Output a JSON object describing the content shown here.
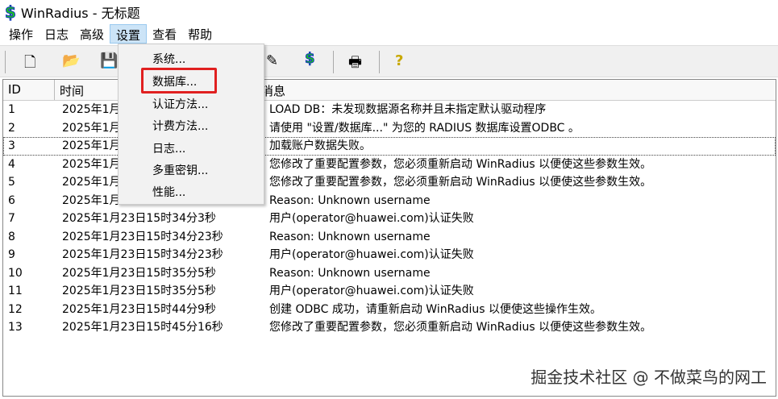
{
  "window": {
    "title": "WinRadius - 无标题"
  },
  "menubar": [
    "操作",
    "日志",
    "高级",
    "设置",
    "查看",
    "帮助"
  ],
  "toolbar": {
    "icons": [
      "new-icon",
      "open-icon",
      "save-icon",
      "edit-icon",
      "dollar-icon",
      "print-icon",
      "help-icon"
    ]
  },
  "dropdown": [
    "系统...",
    "数据库...",
    "认证方法...",
    "计费方法...",
    "日志...",
    "多重密钥...",
    "性能..."
  ],
  "list": {
    "headers": [
      "ID",
      "时间",
      "消息"
    ],
    "rows": [
      [
        "1",
        "2025年1月",
        "LOAD DB：未发现数据源名称并且未指定默认驱动程序"
      ],
      [
        "2",
        "2025年1月",
        "请使用 \"设置/数据库...\" 为您的 RADIUS 数据库设置ODBC 。"
      ],
      [
        "3",
        "2025年1月",
        "加载账户数据失败。"
      ],
      [
        "4",
        "2025年1月",
        "您修改了重要配置参数，您必须重新启动 WinRadius 以便使这些参数生效。"
      ],
      [
        "5",
        "2025年1月",
        "您修改了重要配置参数，您必须重新启动 WinRadius 以便使这些参数生效。"
      ],
      [
        "6",
        "2025年1月",
        "Reason: Unknown username"
      ],
      [
        "7",
        "2025年1月23日15时34分3秒",
        "用户(operator@huawei.com)认证失败"
      ],
      [
        "8",
        "2025年1月23日15时34分23秒",
        "Reason: Unknown username"
      ],
      [
        "9",
        "2025年1月23日15时34分23秒",
        "用户(operator@huawei.com)认证失败"
      ],
      [
        "10",
        "2025年1月23日15时35分5秒",
        "Reason: Unknown username"
      ],
      [
        "11",
        "2025年1月23日15时35分5秒",
        "用户(operator@huawei.com)认证失败"
      ],
      [
        "12",
        "2025年1月23日15时44分9秒",
        "创建 ODBC 成功，请重新启动 WinRadius 以便使这些操作生效。"
      ],
      [
        "13",
        "2025年1月23日15时45分16秒",
        "您修改了重要配置参数，您必须重新启动 WinRadius 以便使这些参数生效。"
      ]
    ]
  },
  "watermark": "掘金技术社区 @ 不做菜鸟的网工"
}
